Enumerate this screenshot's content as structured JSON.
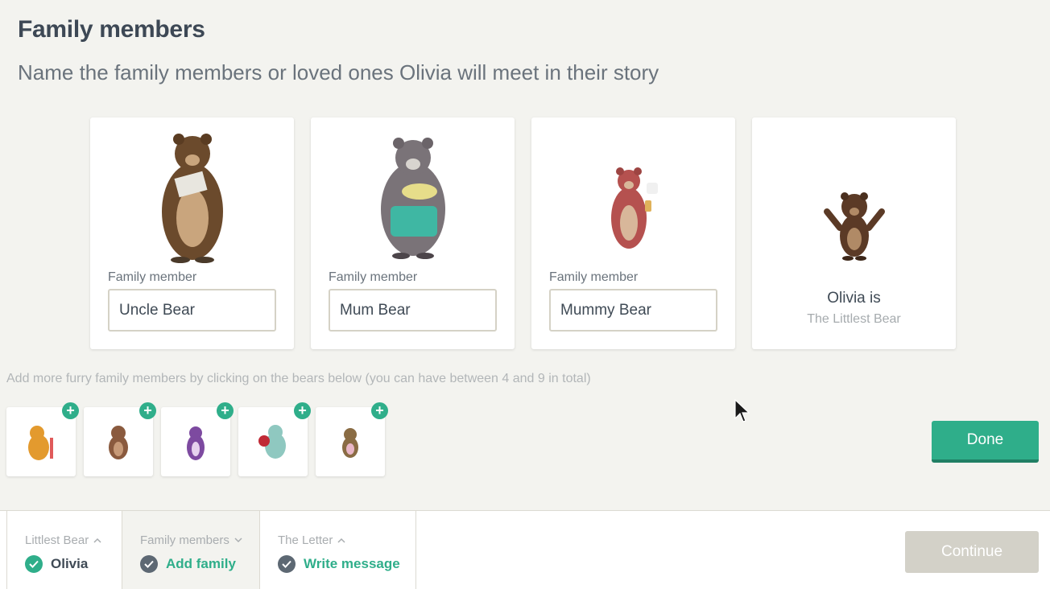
{
  "header": {
    "title": "Family members",
    "subtitle": "Name the family members or loved ones Olivia will meet in their story"
  },
  "members": [
    {
      "label": "Family member",
      "value": "Uncle Bear",
      "icon": "bear-with-letter-icon"
    },
    {
      "label": "Family member",
      "value": "Mum Bear",
      "icon": "bear-with-apron-icon"
    },
    {
      "label": "Family member",
      "value": "Mummy Bear",
      "icon": "bear-pouring-icon"
    }
  ],
  "olivia_card": {
    "name": "Olivia is",
    "role": "The Littlest Bear",
    "icon": "littlest-bear-icon"
  },
  "hint": "Add more furry family members by clicking on the bears below (you can have between 4 and 9 in total)",
  "extra_bears": [
    {
      "icon": "orange-bear-icon",
      "add": "+"
    },
    {
      "icon": "brown-bear-icon",
      "add": "+"
    },
    {
      "icon": "purple-bear-icon",
      "add": "+"
    },
    {
      "icon": "teal-bear-with-ball-icon",
      "add": "+"
    },
    {
      "icon": "small-bear-icon",
      "add": "+"
    }
  ],
  "done_label": "Done",
  "footer": {
    "steps": [
      {
        "title": "Littlest Bear",
        "value": "Olivia",
        "chevron": "up",
        "check": "green",
        "value_color": "#3f4a55"
      },
      {
        "title": "Family members",
        "value": "Add family",
        "chevron": "down",
        "check": "gray",
        "value_color": "#2fae8a"
      },
      {
        "title": "The Letter",
        "value": "Write message",
        "chevron": "up",
        "check": "gray",
        "value_color": "#2fae8a"
      }
    ],
    "continue_label": "Continue"
  },
  "colors": {
    "accent": "#2fae8a",
    "background": "#f3f3ef",
    "disabled": "#d3d1c8"
  }
}
